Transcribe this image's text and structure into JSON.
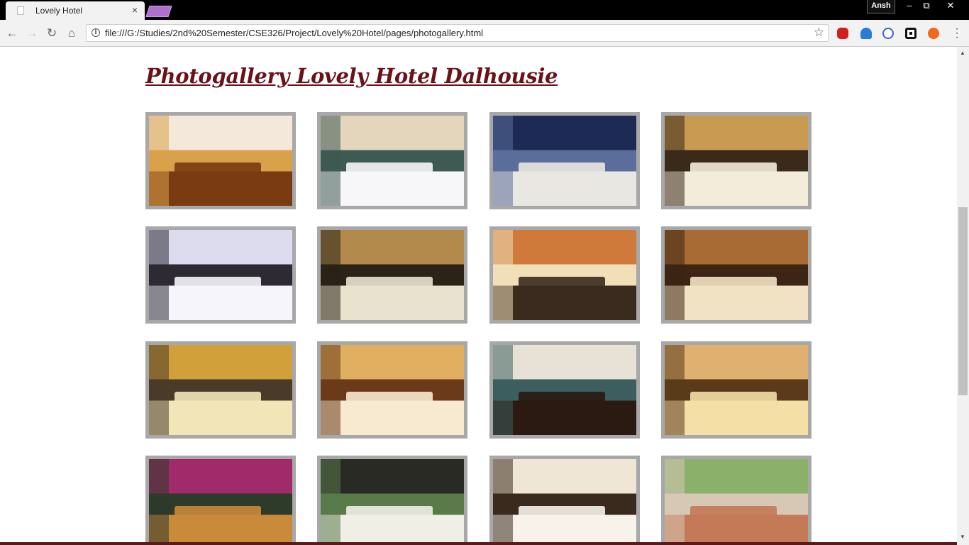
{
  "browser": {
    "tab_title": "Lovely Hotel",
    "tab_close": "×",
    "user_name": "Ansh",
    "url": "file:///G:/Studies/2nd%20Semester/CSE326/Project/Lovely%20Hotel/pages/photogallery.html",
    "window_controls": {
      "minimize": "–",
      "restore": "⧉",
      "close": "✕"
    },
    "nav": {
      "back": "←",
      "forward": "→",
      "reload": "↻",
      "home": "⌂",
      "star": "☆"
    },
    "extensions": [
      "adblock-icon",
      "ghostery-icon",
      "sync-icon",
      "square-extension-icon",
      "fire-extension-icon"
    ]
  },
  "page": {
    "title": "Photogallery Lovely Hotel Dalhousie"
  },
  "gallery": {
    "photos": [
      {
        "name": "photo-bedroom-1",
        "palette": [
          "#f3e8da",
          "#d9a24a",
          "#7a3a12"
        ]
      },
      {
        "name": "photo-bedroom-2",
        "palette": [
          "#e4d6bd",
          "#3e5a52",
          "#f7f7f9"
        ]
      },
      {
        "name": "photo-balcony-night",
        "palette": [
          "#1d2a55",
          "#5b6d9a",
          "#e9e7e2"
        ]
      },
      {
        "name": "photo-bedroom-3",
        "palette": [
          "#c89a52",
          "#3a2a1a",
          "#f3ecdb"
        ]
      },
      {
        "name": "photo-bedroom-4",
        "palette": [
          "#dcdcee",
          "#2d2a34",
          "#f6f5fb"
        ]
      },
      {
        "name": "photo-bedroom-5",
        "palette": [
          "#b28a4c",
          "#2b2218",
          "#e9e2cf"
        ]
      },
      {
        "name": "photo-restaurant",
        "palette": [
          "#cf7a3a",
          "#f1dfb8",
          "#3b2b1e"
        ]
      },
      {
        "name": "photo-bedroom-6",
        "palette": [
          "#a86b33",
          "#3d2414",
          "#f2e2c4"
        ]
      },
      {
        "name": "photo-bedroom-7",
        "palette": [
          "#d2a03a",
          "#4a3a2a",
          "#f2e6b8"
        ]
      },
      {
        "name": "photo-bedroom-8",
        "palette": [
          "#e0b060",
          "#6a3a1a",
          "#f7ead0"
        ]
      },
      {
        "name": "photo-bedroom-9",
        "palette": [
          "#e8e2d6",
          "#3d5e5e",
          "#2a1a12"
        ]
      },
      {
        "name": "photo-bedroom-10",
        "palette": [
          "#e0b070",
          "#5a3a1a",
          "#f4dfa6"
        ]
      },
      {
        "name": "photo-reception",
        "palette": [
          "#a12a6a",
          "#2e3a2a",
          "#c98a3a"
        ]
      },
      {
        "name": "photo-bedroom-11",
        "palette": [
          "#2a2a24",
          "#5a7a4a",
          "#efefe6"
        ]
      },
      {
        "name": "photo-bedroom-12",
        "palette": [
          "#efe6d6",
          "#3a2a1e",
          "#f7f3ea"
        ]
      },
      {
        "name": "photo-garden-terrace",
        "palette": [
          "#8ab06a",
          "#d7c8b6",
          "#c47a56"
        ]
      }
    ]
  }
}
